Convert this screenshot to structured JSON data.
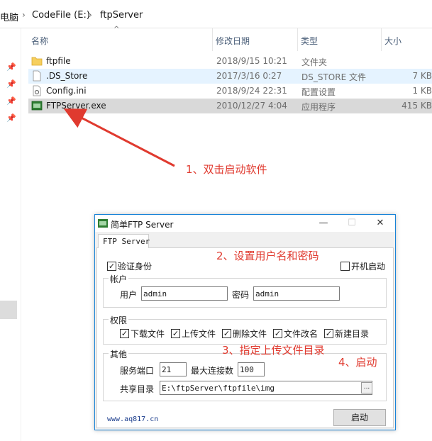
{
  "breadcrumb": {
    "items": [
      "电脑",
      "CodeFile (E:)",
      "ftpServer"
    ],
    "separator": "›"
  },
  "columns": {
    "name": "名称",
    "date": "修改日期",
    "type": "类型",
    "size": "大小"
  },
  "files": [
    {
      "name": "ftpfile",
      "date": "2018/9/15 10:21",
      "type": "文件夹",
      "size": "",
      "icon": "folder-icon"
    },
    {
      "name": ".DS_Store",
      "date": "2017/3/16 0:27",
      "type": "DS_STORE 文件",
      "size": "7 KB",
      "icon": "file-icon"
    },
    {
      "name": "Config.ini",
      "date": "2018/9/24 22:31",
      "type": "配置设置",
      "size": "1 KB",
      "icon": "settings-file-icon"
    },
    {
      "name": "FTPServer.exe",
      "date": "2010/12/27 4:04",
      "type": "应用程序",
      "size": "415 KB",
      "icon": "app-icon"
    }
  ],
  "annotations": {
    "step1": "1、双击启动软件",
    "step2": "2、设置用户名和密码",
    "step3": "3、指定上传文件目录",
    "step4": "4、启动",
    "color": "#e03a2f"
  },
  "dialog": {
    "title": "简单FTP Server",
    "minimize": "—",
    "maximize": "☐",
    "close": "✕",
    "tab": "FTP Server",
    "verify_identity": "验证身份",
    "autostart": "开机启动",
    "account": {
      "group": "帐户",
      "user_label": "用户",
      "user_value": "admin",
      "password_label": "密码",
      "password_value": "admin"
    },
    "permissions": {
      "group": "权限",
      "items": [
        "下载文件",
        "上传文件",
        "删除文件",
        "文件改名",
        "新建目录"
      ]
    },
    "other": {
      "group": "其他",
      "port_label": "服务端口",
      "port_value": "21",
      "maxconn_label": "最大连接数",
      "maxconn_value": "100",
      "share_label": "共享目录",
      "share_value": "E:\\ftpServer\\ftpfile\\img",
      "browse": "..."
    },
    "website": "www.aq817.cn",
    "start_button": "启动"
  },
  "colors": {
    "selected_row": "#d9d9d9",
    "hover_row": "#e5f3ff",
    "dialog_border": "#1883d7"
  }
}
